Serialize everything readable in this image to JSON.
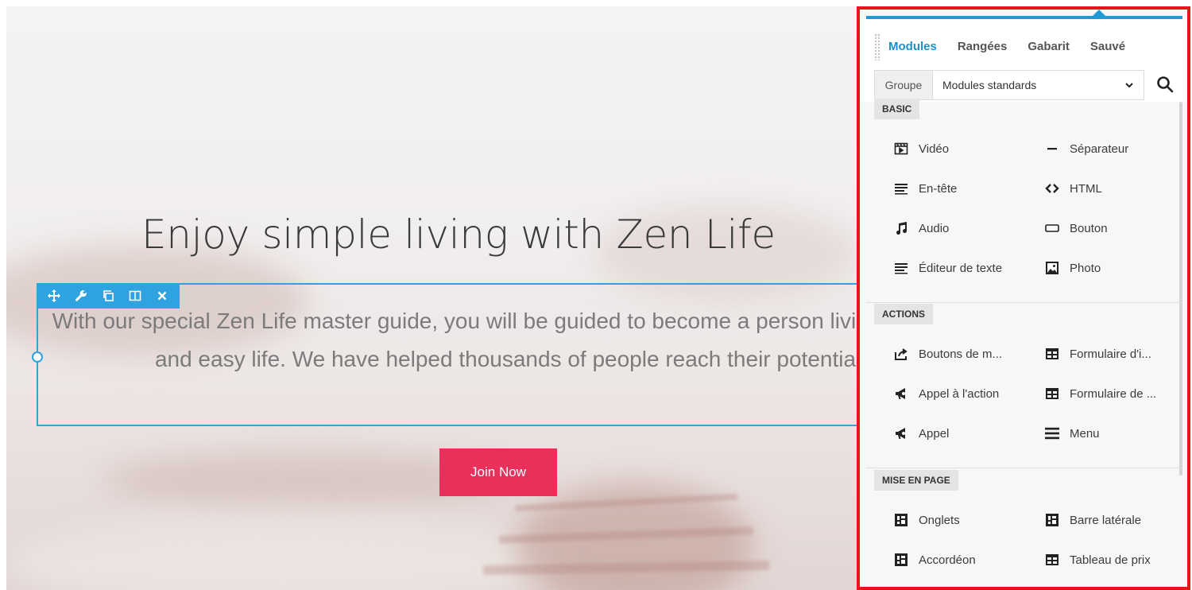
{
  "hero": {
    "title": "Enjoy simple living with Zen Life",
    "paragraph": "With our special Zen Life master guide, you will be guided to become a person living a simple and easy life. We have helped thousands of people reach their potential.",
    "cta_label": "Join Now",
    "accent_color": "#e8305a"
  },
  "module_toolbar": {
    "icons": [
      "move-icon",
      "wrench-icon",
      "duplicate-icon",
      "columns-icon",
      "close-icon"
    ],
    "accent_color": "#2ea3e0"
  },
  "panel": {
    "tabs": [
      "Modules",
      "Rangées",
      "Gabarit",
      "Sauvé"
    ],
    "active_tab": "Modules",
    "group_label": "Groupe",
    "group_value": "Modules standards",
    "accent_color": "#1f8fc9",
    "highlight_border_color": "#e8141b",
    "sections": [
      {
        "title": "BASIC",
        "items": [
          {
            "label": "Vidéo",
            "icon": "video-icon"
          },
          {
            "label": "Séparateur",
            "icon": "separator-icon"
          },
          {
            "label": "En-tête",
            "icon": "heading-icon"
          },
          {
            "label": "HTML",
            "icon": "code-icon"
          },
          {
            "label": "Audio",
            "icon": "music-note-icon"
          },
          {
            "label": "Bouton",
            "icon": "button-icon"
          },
          {
            "label": "Éditeur de texte",
            "icon": "text-editor-icon"
          },
          {
            "label": "Photo",
            "icon": "photo-icon"
          }
        ]
      },
      {
        "title": "ACTIONS",
        "items": [
          {
            "label": "Boutons de m...",
            "icon": "share-icon"
          },
          {
            "label": "Formulaire d'i...",
            "icon": "form-icon"
          },
          {
            "label": "Appel à l'action",
            "icon": "megaphone-icon"
          },
          {
            "label": "Formulaire de ...",
            "icon": "form-icon"
          },
          {
            "label": "Appel",
            "icon": "megaphone-icon"
          },
          {
            "label": "Menu",
            "icon": "menu-icon"
          }
        ]
      },
      {
        "title": "MISE EN PAGE",
        "items": [
          {
            "label": "Onglets",
            "icon": "layout-icon"
          },
          {
            "label": "Barre latérale",
            "icon": "layout-icon"
          },
          {
            "label": "Accordéon",
            "icon": "layout-icon"
          },
          {
            "label": "Tableau de prix",
            "icon": "table-icon"
          }
        ]
      }
    ]
  }
}
